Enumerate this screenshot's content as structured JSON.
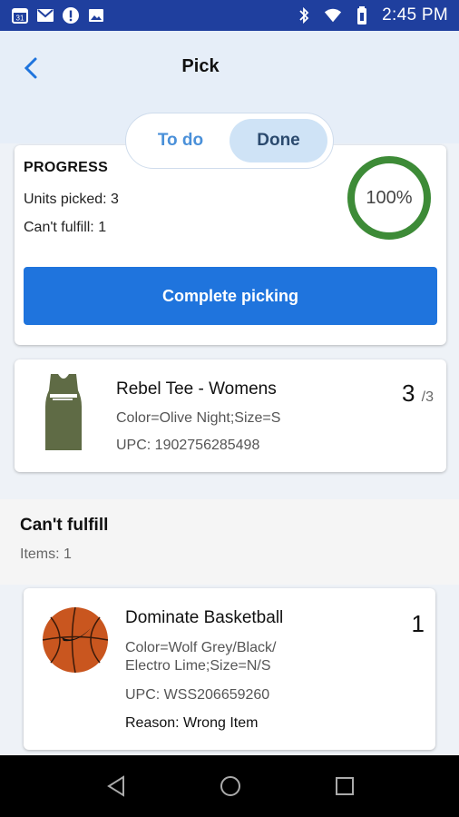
{
  "status_bar": {
    "time": "2:45 PM",
    "left_icons": [
      "calendar-icon",
      "gmail-icon",
      "info-icon",
      "image-icon"
    ],
    "right_icons": [
      "bluetooth-icon",
      "wifi-icon",
      "battery-icon"
    ]
  },
  "header": {
    "title": "Pick"
  },
  "tabs": [
    {
      "label": "To do",
      "active": false
    },
    {
      "label": "Done",
      "active": true
    }
  ],
  "progress": {
    "heading": "PROGRESS",
    "units_picked": "Units picked: 3",
    "cant_fulfill": "Can't fulfill: 1",
    "percent_label": "100%",
    "percent": 1.0,
    "ring_color": "#3d8b37",
    "button_label": "Complete picking"
  },
  "picked_item": {
    "name": "Rebel Tee  - Womens",
    "attributes": "Color=Olive Night;Size=S",
    "upc": "UPC: 1902756285498",
    "qty": "3",
    "qty_total": "/3"
  },
  "cant_fulfill_section": {
    "title": "Can't fulfill",
    "count": "Items: 1"
  },
  "unfulfilled_item": {
    "name": "Dominate Basketball",
    "attributes_line1": "Color=Wolf Grey/Black/",
    "attributes_line2": "Electro Lime;Size=N/S",
    "upc": "UPC: WSS206659260",
    "reason": "Reason: Wrong Item",
    "qty": "1"
  },
  "colors": {
    "primary": "#1f74dd",
    "status_bar": "#1f3f9e",
    "progress_ring": "#3d8b37"
  }
}
